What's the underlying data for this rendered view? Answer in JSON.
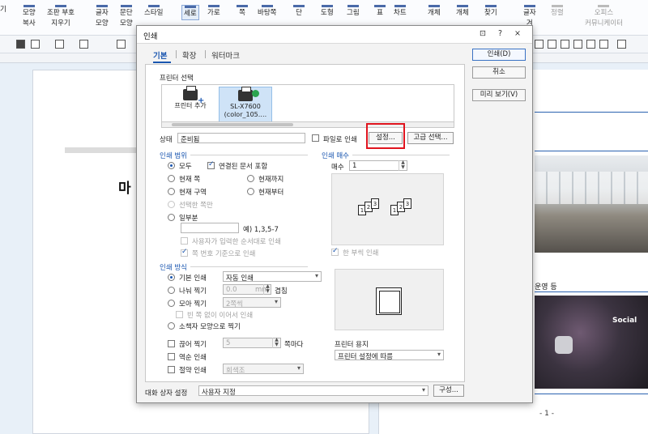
{
  "app": {
    "ribbon": [
      {
        "label": "모양\n복사"
      },
      {
        "label": "조판 부호\n지우기"
      },
      {
        "label": "글자\n모양"
      },
      {
        "label": "문단\n모양"
      },
      {
        "label": "스타일"
      },
      {
        "label": "세로"
      },
      {
        "label": "가로"
      },
      {
        "label": "쪽"
      },
      {
        "label": "바탕쪽"
      },
      {
        "label": "단"
      },
      {
        "label": "도형"
      },
      {
        "label": "그림"
      },
      {
        "label": "표"
      },
      {
        "label": "차트"
      },
      {
        "label": "개체"
      },
      {
        "label": "개체"
      },
      {
        "label": "찾기"
      },
      {
        "label": "글자\n겨"
      },
      {
        "label": "정렬"
      },
      {
        "label": "오피스\n커뮤니케이터"
      }
    ],
    "doc_title_partial": "마",
    "right_text": "운영 등",
    "photo_label": "Social",
    "page_number": "- 1 -"
  },
  "dialog": {
    "title": "인쇄",
    "controls": [
      "⊡",
      "?",
      "×"
    ],
    "tabs": [
      {
        "label": "기본",
        "active": true
      },
      {
        "label": "확장",
        "active": false
      },
      {
        "label": "워터마크",
        "active": false
      }
    ],
    "printer_section": "프린터 선택",
    "printers": [
      {
        "name": "프린터 추가",
        "selected": false
      },
      {
        "name": "SL-X7600\n(color_105.…",
        "selected": true
      }
    ],
    "status_label": "상태",
    "status_value": "준비됨",
    "print_to_file": "파일로 인쇄",
    "settings_button": "설정...",
    "advanced_button": "고급 선택...",
    "range": {
      "title": "인쇄 범위",
      "all": "모두",
      "linked_docs": "연결된 문서 포함",
      "current_page": "현재 쪽",
      "to_current": "현재까지",
      "current_section": "현재 구역",
      "from_current": "현재부터",
      "selection": "선택한 쪽만",
      "partial": "일부분",
      "partial_example": "예) 1,3,5-7",
      "user_order": "사용자가 입력한 순서대로 인쇄",
      "page_number_basis": "쪽 번호 기준으로 인쇄"
    },
    "copies": {
      "title": "인쇄 매수",
      "label": "매수",
      "value": "1",
      "collate": "한 부씩 인쇄"
    },
    "method": {
      "title": "인쇄 방식",
      "basic": "기본 인쇄",
      "basic_value": "자동 인쇄",
      "split": "나눠 찍기",
      "split_value": "0.0",
      "split_unit": "mm",
      "overlap": "겹침",
      "gather": "모아 찍기",
      "gather_value": "2쪽씩",
      "no_blank": "빈 쪽 없이 이어서 인쇄",
      "booklet": "소책자 모양으로 찍기",
      "skip": "끊어 찍기",
      "skip_value": "5",
      "skip_unit": "쪽마다",
      "reverse": "역순 인쇄",
      "save": "절약 인쇄",
      "save_value": "회색조",
      "paper_label": "프린터 용지",
      "paper_value": "프린터 설정에 따름"
    },
    "dialog_setting_label": "대화 상자 설정",
    "dialog_setting_value": "사용자 지정",
    "config_button": "구성...",
    "print_button": "인쇄(D)",
    "cancel_button": "취소",
    "preview_button": "미리 보기(V)",
    "highlight_color": "#e0141e",
    "accent_color": "#1a56b0"
  }
}
